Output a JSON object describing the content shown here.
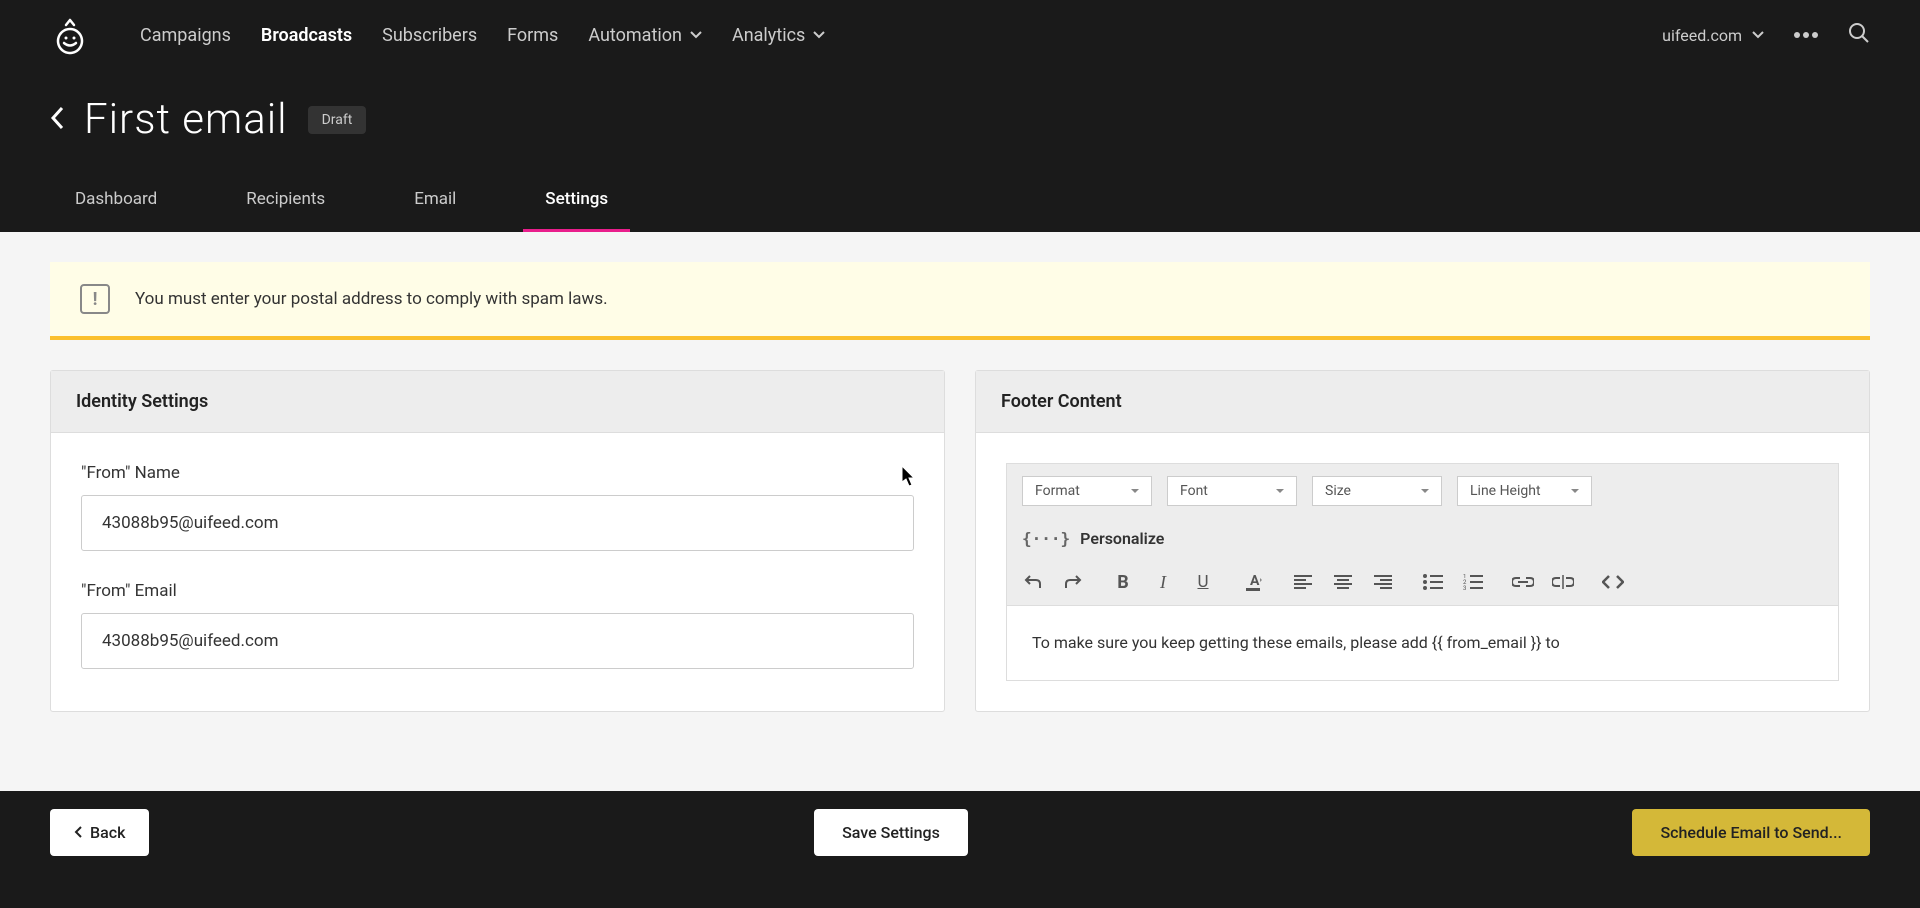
{
  "nav": {
    "campaigns": "Campaigns",
    "broadcasts": "Broadcasts",
    "subscribers": "Subscribers",
    "forms": "Forms",
    "automation": "Automation",
    "analytics": "Analytics"
  },
  "domain": "uifeed.com",
  "page": {
    "title": "First email",
    "badge": "Draft"
  },
  "subnav": {
    "dashboard": "Dashboard",
    "recipients": "Recipients",
    "email": "Email",
    "settings": "Settings"
  },
  "alert": {
    "message": "You must enter your postal address to comply with spam laws."
  },
  "identity": {
    "header": "Identity Settings",
    "from_name_label": "\"From\" Name",
    "from_name_value": "43088b95@uifeed.com",
    "from_email_label": "\"From\" Email",
    "from_email_value": "43088b95@uifeed.com"
  },
  "footer_content": {
    "header": "Footer Content",
    "toolbar": {
      "format": "Format",
      "font": "Font",
      "size": "Size",
      "line_height": "Line Height",
      "personalize": "Personalize"
    },
    "content": "To make sure you keep getting these emails, please add {{ from_email }} to"
  },
  "buttons": {
    "back": "Back",
    "save": "Save Settings",
    "schedule": "Schedule Email to Send..."
  }
}
